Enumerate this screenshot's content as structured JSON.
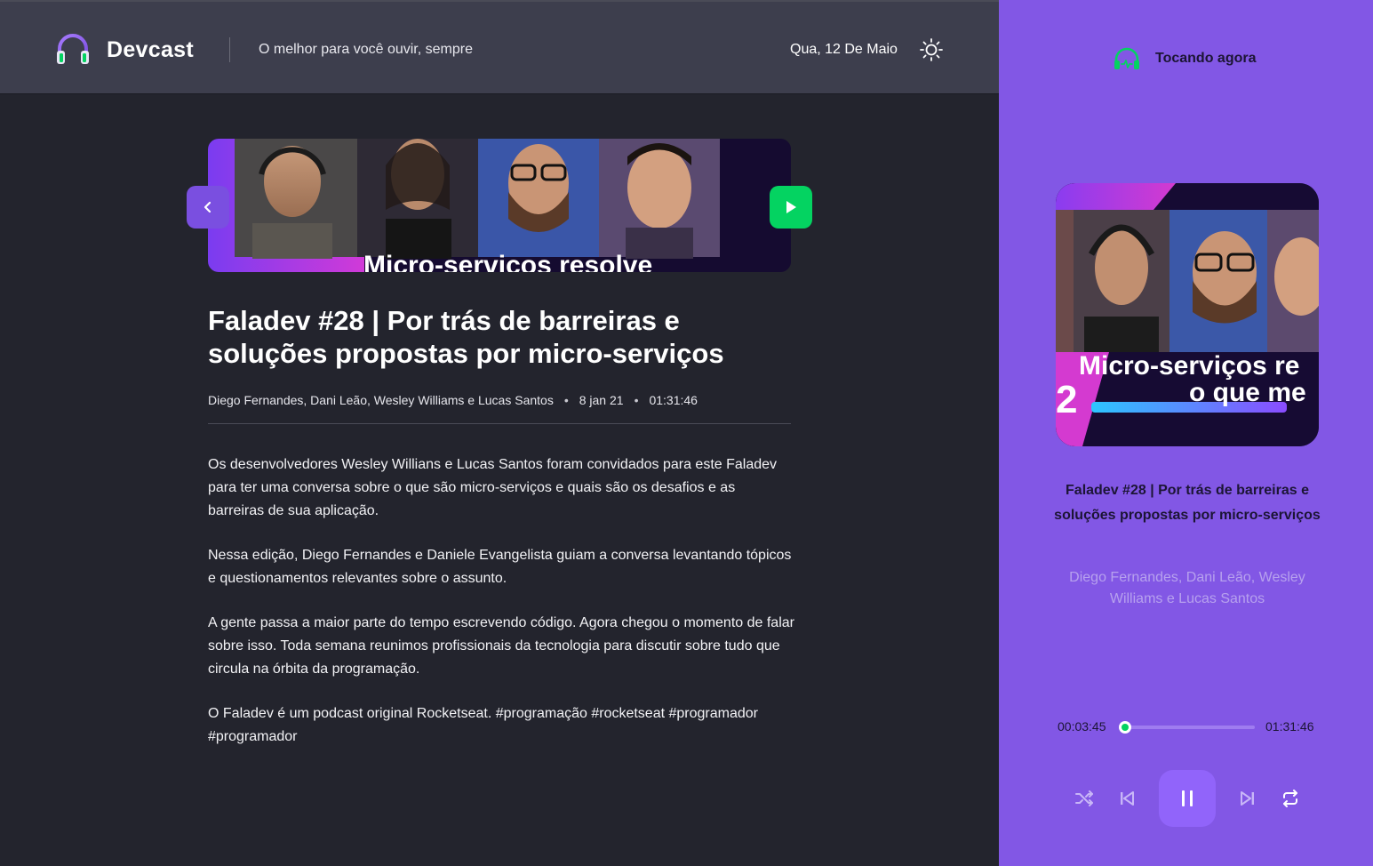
{
  "header": {
    "brand": "Devcast",
    "tagline": "O melhor para você ouvir, sempre",
    "date": "Qua, 12 De Maio"
  },
  "episode": {
    "banner_text": "Micro-serviços resolve",
    "title": "Faladev #28 | Por trás de barreiras e soluções propostas por micro-serviços",
    "members": "Diego Fernandes, Dani Leão, Wesley Williams e Lucas Santos",
    "published_at": "8 jan 21",
    "duration": "01:31:46",
    "description": [
      "Os desenvolvedores Wesley Willians e Lucas Santos foram convidados para este Faladev para ter uma conversa sobre o que são micro-serviços e quais são os desafios e as barreiras de sua aplicação.",
      "Nessa edição, Diego Fernandes e Daniele Evangelista guiam a conversa levantando tópicos e questionamentos relevantes sobre o assunto.",
      "A gente passa a maior parte do tempo escrevendo código. Agora chegou o momento de falar sobre isso. Toda semana reunimos profissionais da tecnologia para discutir sobre tudo que circula na órbita da programação.",
      "O Faladev é um podcast original Rocketseat.  #programação #rocketseat #programador #programador"
    ]
  },
  "player": {
    "label": "Tocando agora",
    "cover_line1": "Micro-serviços re",
    "cover_line2": "o que me",
    "cover_number": "2",
    "title": "Faladev #28 | Por trás de barreiras e soluções propostas por micro-serviços",
    "members": "Diego Fernandes, Dani Leão, Wesley Williams e Lucas Santos",
    "current_time": "00:03:45",
    "total_time": "01:31:46",
    "progress": 0.04
  },
  "colors": {
    "purple": "#8257e5",
    "green": "#04d361",
    "background": "#23242d",
    "header": "#3d3e4d"
  },
  "icons": [
    "headphones-logo-icon",
    "sun-icon",
    "chevron-left-icon",
    "play-icon",
    "now-playing-icon",
    "shuffle-icon",
    "previous-icon",
    "pause-icon",
    "next-icon",
    "repeat-icon"
  ]
}
